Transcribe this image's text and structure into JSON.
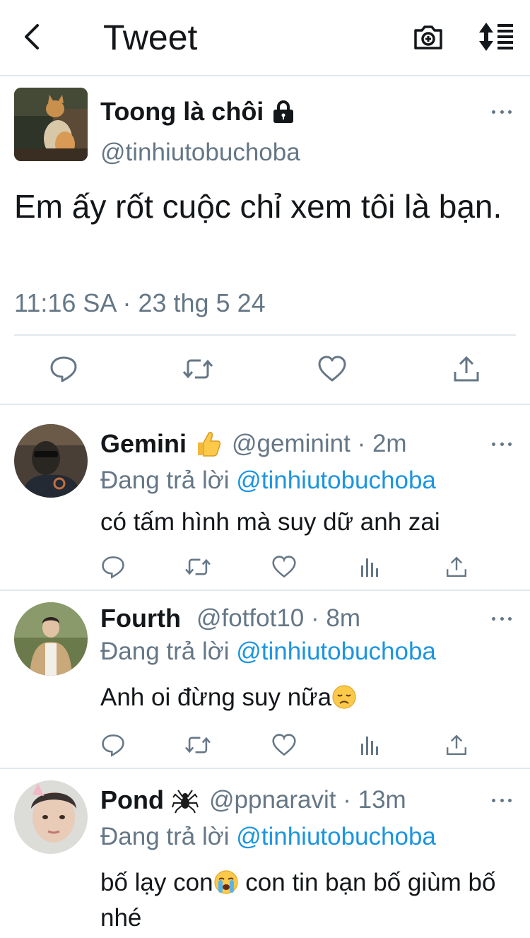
{
  "header": {
    "title": "Tweet",
    "back_icon": "chevron-left-icon",
    "camera_icon": "camera-plus-icon",
    "sort_icon": "sort-list-icon"
  },
  "main_tweet": {
    "name": "Toong là chôi",
    "locked_icon": "lock-icon",
    "handle": "@tinhiutobuchoba",
    "text": "Em ấy rốt cuộc chỉ xem tôi là bạn.",
    "timestamp": "11:16 SA · 23 thg 5 24",
    "actions": [
      "reply-icon",
      "retweet-icon",
      "like-icon",
      "share-icon"
    ]
  },
  "replies": [
    {
      "name": "Gemini",
      "name_emoji": "thumbs-up-emoji",
      "handle_time": "@geminint · 2m",
      "replying_prefix": "Đang trả lời ",
      "replying_to": "@tinhiutobuchoba",
      "text": "có tấm hình mà suy dữ anh zai"
    },
    {
      "name": "Fourth",
      "name_emoji": "",
      "handle_time": "@fotfot10 · 8m",
      "replying_prefix": "Đang trả lời ",
      "replying_to": "@tinhiutobuchoba",
      "text": "Anh oi đừng suy nữa",
      "text_emoji": "disappointed-face-emoji"
    },
    {
      "name": "Pond",
      "name_emoji": "spider-emoji",
      "handle_time": "@ppnaravit · 13m",
      "replying_prefix": "Đang trả lời ",
      "replying_to": "@tinhiutobuchoba",
      "text_part1": "bố lạy con",
      "text_emoji": "loudly-crying-face-emoji",
      "text_part2": " con tin bạn bố giùm bố nhé"
    }
  ],
  "colors": {
    "text": "#14171a",
    "secondary": "#657786",
    "link": "#1b95e0",
    "divider": "#e1e8ed"
  }
}
